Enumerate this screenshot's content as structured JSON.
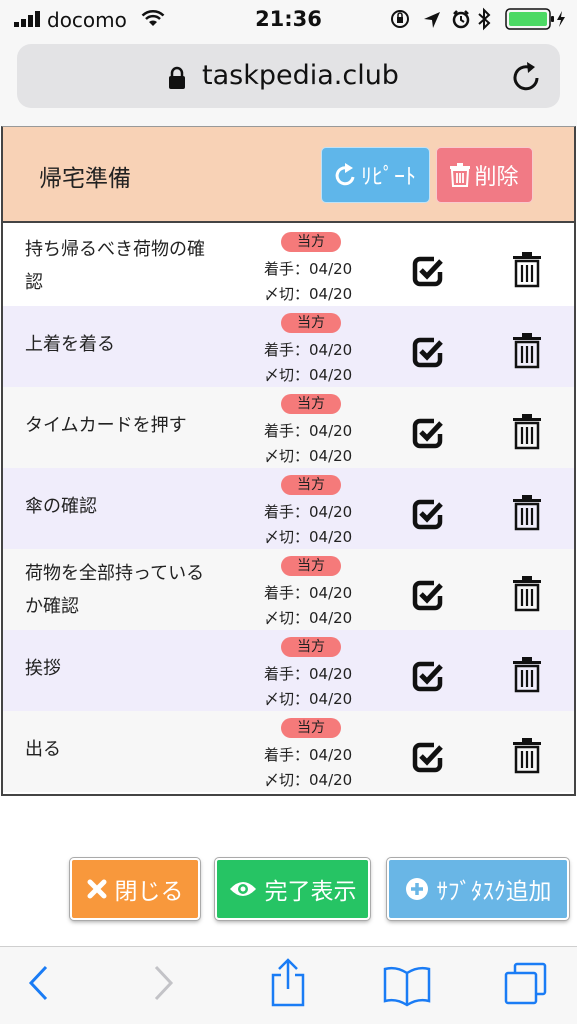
{
  "status_bar": {
    "carrier": "docomo",
    "time": "21:36",
    "battery_color": "#4cd964"
  },
  "browser": {
    "url": "taskpedia.club"
  },
  "panel": {
    "title": "帰宅準備",
    "repeat_label": "ﾘﾋﾟｰﾄ",
    "delete_label": "削除",
    "header_color": "#f8d2b6"
  },
  "tasks": [
    {
      "name_line1": "持ち帰るべき荷物の確",
      "name_line2": "認",
      "badge": "当方",
      "start": "着手：04/20",
      "due": "〆切：04/20"
    },
    {
      "name_line1": "上着を着る",
      "name_line2": "",
      "badge": "当方",
      "start": "着手：04/20",
      "due": "〆切：04/20"
    },
    {
      "name_line1": "タイムカードを押す",
      "name_line2": "",
      "badge": "当方",
      "start": "着手：04/20",
      "due": "〆切：04/20"
    },
    {
      "name_line1": "傘の確認",
      "name_line2": "",
      "badge": "当方",
      "start": "着手：04/20",
      "due": "〆切：04/20"
    },
    {
      "name_line1": "荷物を全部持っている",
      "name_line2": "か確認",
      "badge": "当方",
      "start": "着手：04/20",
      "due": "〆切：04/20"
    },
    {
      "name_line1": "挨拶",
      "name_line2": "",
      "badge": "当方",
      "start": "着手：04/20",
      "due": "〆切：04/20"
    },
    {
      "name_line1": "出る",
      "name_line2": "",
      "badge": "当方",
      "start": "着手：04/20",
      "due": "〆切：04/20"
    }
  ],
  "actions": {
    "close_label": "閉じる",
    "show_done_label": "完了表示",
    "add_subtask_label": "ｻﾌﾞﾀｽｸ追加"
  }
}
